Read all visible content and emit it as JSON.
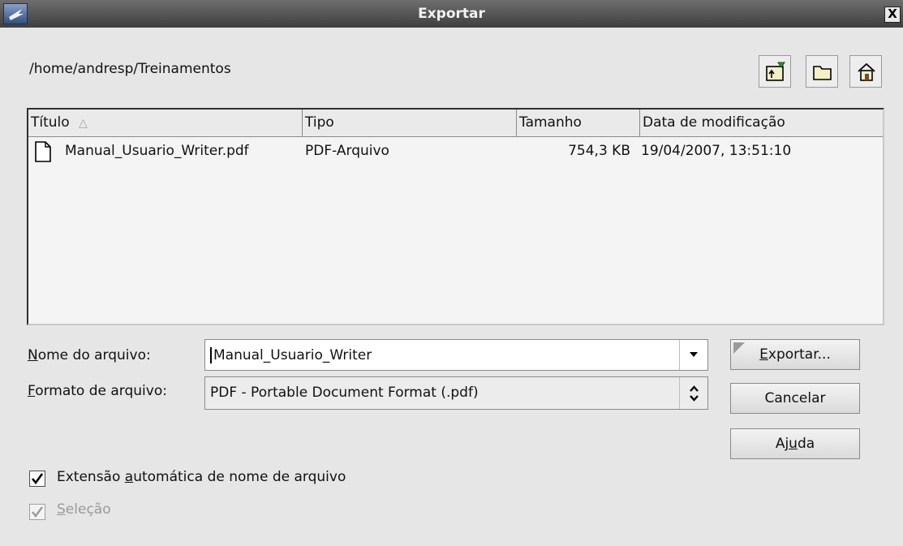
{
  "window": {
    "title": "Exportar",
    "close_glyph": "X"
  },
  "current_path": "/home/andresp/Treinamentos",
  "toolbar": {
    "icons": [
      "folder-up-icon",
      "new-folder-icon",
      "home-icon"
    ]
  },
  "file_list": {
    "columns": {
      "title": "Título",
      "type": "Tipo",
      "size": "Tamanho",
      "modified": "Data de modificação"
    },
    "sort_indicator": "△",
    "rows": [
      {
        "name": "Manual_Usuario_Writer.pdf",
        "type": "PDF-Arquivo",
        "size": "754,3 KB",
        "modified": "19/04/2007, 13:51:10"
      }
    ]
  },
  "form": {
    "filename_label_pre": "",
    "filename_label_u": "N",
    "filename_label_post": "ome do arquivo:",
    "filename_value": "Manual_Usuario_Writer",
    "format_label_u": "F",
    "format_label_post": "ormato de arquivo:",
    "format_value": "PDF - Portable Document Format (.pdf)"
  },
  "buttons": {
    "export_u": "E",
    "export_rest": "xportar...",
    "cancel": "Cancelar",
    "help_pre": "Aj",
    "help_u": "u",
    "help_post": "da"
  },
  "options": {
    "auto_extension_pre": "Extensão ",
    "auto_extension_u": "a",
    "auto_extension_post": "utomática de nome de arquivo",
    "auto_extension_checked": true,
    "selection_u": "S",
    "selection_post": "eleção",
    "selection_checked": true,
    "selection_enabled": false
  }
}
